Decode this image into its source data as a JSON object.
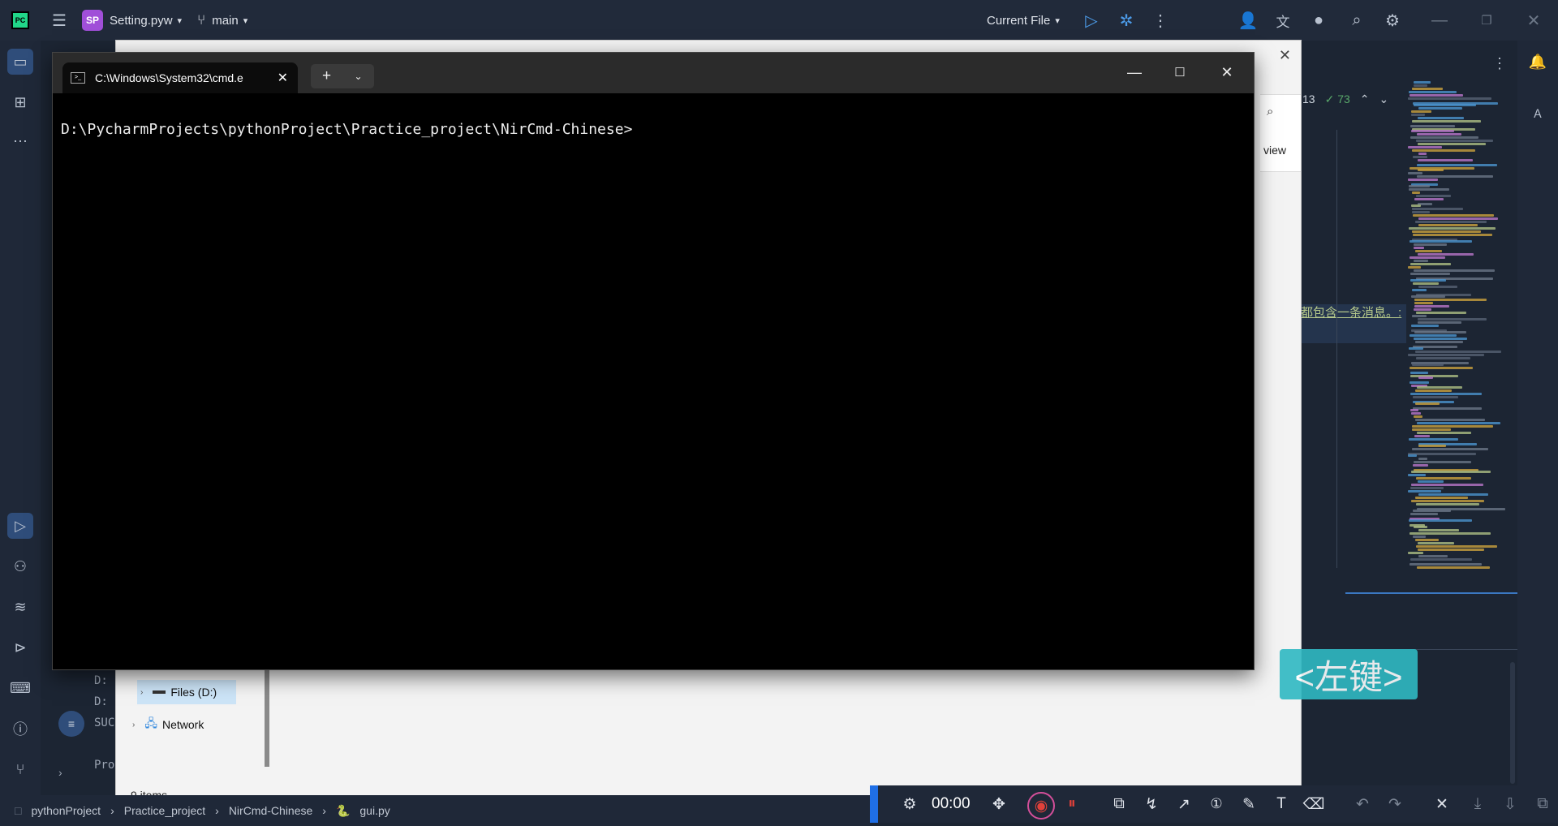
{
  "ide": {
    "project_badge": "SP",
    "file_name": "Setting.pyw",
    "branch": "main",
    "run_config": "Current File",
    "right_panel": {
      "warnings": "13",
      "checks": "73",
      "view_text": "view",
      "chinese_text": "都包含一条消息。:",
      "bottom_lines": [
        "D:",
        "D:",
        "SUC",
        "Pro"
      ]
    },
    "breadcrumbs": [
      "pythonProject",
      "Practice_project",
      "NirCmd-Chinese",
      "gui.py"
    ]
  },
  "explorer": {
    "tree": [
      {
        "label": "Files (D:)"
      },
      {
        "label": "Network"
      }
    ],
    "item_count": "9 items"
  },
  "terminal": {
    "tab_title": "C:\\Windows\\System32\\cmd.e",
    "prompt": "D:\\PycharmProjects\\pythonProject\\Practice_project\\NirCmd-Chinese>"
  },
  "recorder": {
    "timer": "00:00",
    "key_hint": "<左键>"
  },
  "colors": {
    "accent": "#1f6fe6",
    "terminal_bg": "#000000",
    "ide_bg": "#1c2533",
    "record_red": "#e0413a",
    "key_hint_bg": "#2fb9c3"
  },
  "icons": [
    "hamburger-icon",
    "branch-icon",
    "run-icon",
    "debug-icon",
    "more-icon",
    "add-user-icon",
    "translate-icon",
    "search-icon",
    "gear-icon",
    "notification-icon",
    "folder-icon",
    "structure-icon",
    "play-icon",
    "python-icon",
    "layers-icon",
    "terminal-icon",
    "problems-icon",
    "git-icon",
    "settings-icon",
    "move-icon",
    "record-icon",
    "pause-icon",
    "shapes-icon",
    "polyline-icon",
    "arrow-icon",
    "number-icon",
    "pen-icon",
    "text-icon",
    "eraser-icon",
    "undo-icon",
    "redo-icon",
    "close-icon",
    "download-icon",
    "copy-icon"
  ]
}
